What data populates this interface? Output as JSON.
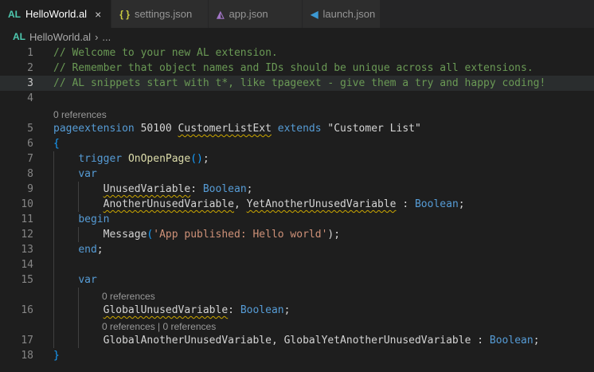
{
  "tabs": [
    {
      "icon": "AL",
      "label": "HelloWorld.al",
      "close": "×"
    },
    {
      "icon": "{ }",
      "label": "settings.json"
    },
    {
      "icon": "◭",
      "label": "app.json"
    },
    {
      "icon": "◀",
      "label": "launch.json"
    }
  ],
  "breadcrumb": {
    "icon": "AL",
    "file": "HelloWorld.al",
    "sep": "›",
    "rest": "..."
  },
  "lenses": {
    "l5": "0 references",
    "l16": "0 references",
    "l17": "0 references | 0 references"
  },
  "lines": {
    "n1": "1",
    "n2": "2",
    "n3": "3",
    "n4": "4",
    "n5": "5",
    "n6": "6",
    "n7": "7",
    "n8": "8",
    "n9": "9",
    "n10": "10",
    "n11": "11",
    "n12": "12",
    "n13": "13",
    "n14": "14",
    "n15": "15",
    "n16": "16",
    "n17": "17",
    "n18": "18"
  },
  "code": {
    "c1": "// Welcome to your new AL extension.",
    "c2": "// Remember that object names and IDs should be unique across all extensions.",
    "c3": "// AL snippets start with t*, like tpageext - give them a try and happy coding!",
    "kw_pageext": "pageextension",
    "id_num": "50100",
    "id_name": "CustomerListExt",
    "kw_extends": "extends",
    "str_target": "\"Customer List\"",
    "lbrace": "{",
    "kw_trigger": "trigger",
    "fn_onopen": "OnOpenPage",
    "parens": "()",
    "semi": ";",
    "kw_var": "var",
    "v1": "UnusedVariable",
    "colon": ": ",
    "kw_boolean": "Boolean",
    "v2": "AnotherUnusedVariable",
    "comma": ", ",
    "v3": "YetAnotherUnusedVariable",
    "spcolon": " : ",
    "kw_begin": "begin",
    "fn_message": "Message",
    "lparen": "(",
    "str_msg": "'App published: Hello world'",
    "rparen_semi": ");",
    "kw_end": "end",
    "kw_var2": "var",
    "g1": "GlobalUnusedVariable",
    "g2": "GlobalAnotherUnusedVariable",
    "g3": "GlobalYetAnotherUnusedVariable",
    "rbrace": "}"
  }
}
